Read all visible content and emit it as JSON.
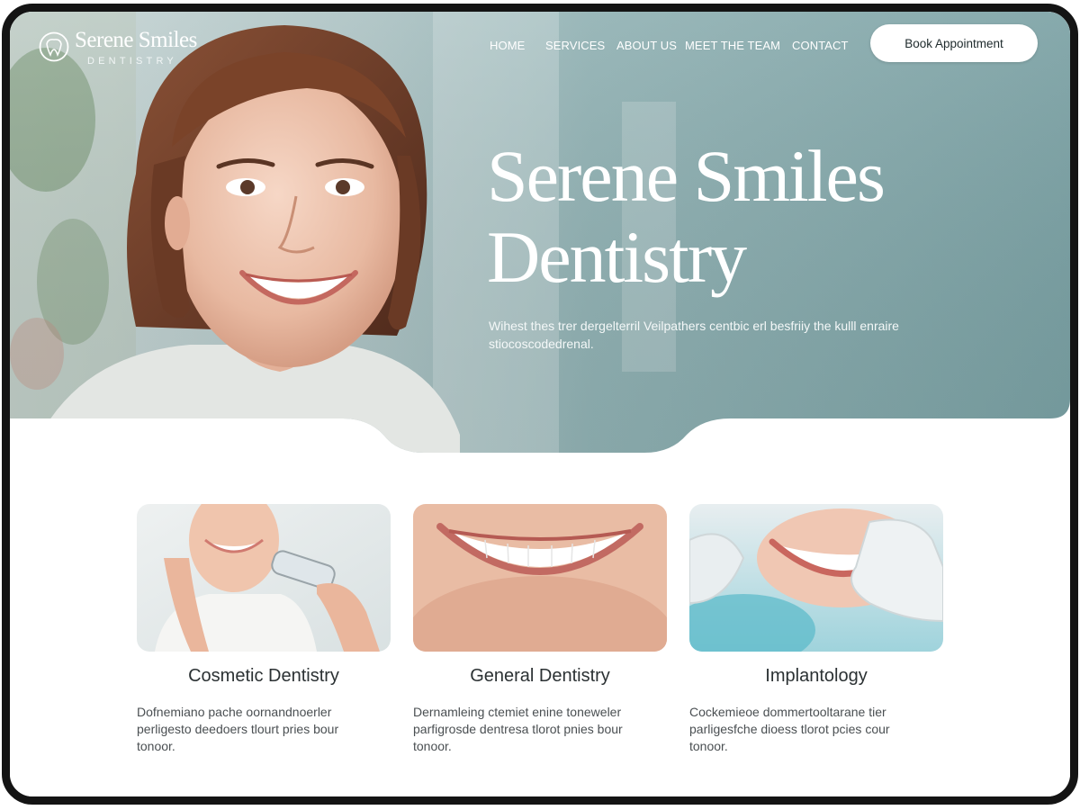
{
  "brand": {
    "name": "Serene Smiles",
    "subtitle": "DENTISTRY"
  },
  "nav": {
    "items": [
      "HOME",
      "SERVICES",
      "ABOUT US",
      "MEET THE TEAM",
      "CONTACT"
    ],
    "cta_label": "Book Appointment"
  },
  "hero": {
    "title": "Serene Smiles Dentistry",
    "subtitle": "Wihest thes trer dergelterril Veilpathers centbic erl besfriiy the kulll enraire stiocoscodedrenal."
  },
  "services": [
    {
      "title": "Cosmetic Dentistry",
      "description": "Dofnemiano pache oornandnoerler perligesto deedoers tlourt pries bour tonoor."
    },
    {
      "title": "General Dentistry",
      "description": "Dernamleing ctemiet enine toneweler parfigrosde dentresa tlorot pnies bour tonoor."
    },
    {
      "title": "Implantology",
      "description": "Cockemieoe dommertooltarane tier parligesfche dioess tlorot pcies cour tonoor."
    }
  ],
  "colors": {
    "hero_teal": "#7ea3a6",
    "frame": "#141414",
    "cta_bg": "#ffffff",
    "text_dark": "#2b3133"
  },
  "icons": {
    "logo": "tooth-logo-icon"
  }
}
